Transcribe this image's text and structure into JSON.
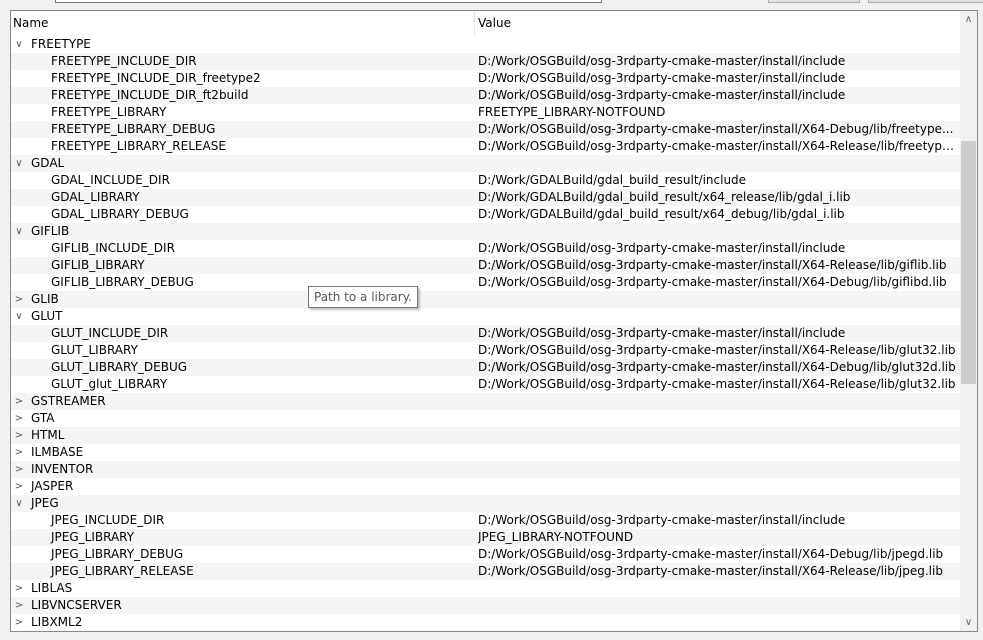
{
  "header": {
    "name": "Name",
    "value": "Value"
  },
  "tooltip": "Path to a library.",
  "scrollbar": {
    "up_icon": "chevron-up",
    "down_icon": "chevron-down"
  },
  "colors": {
    "row_alt": "#f5f5f5",
    "border": "#828790",
    "thumb": "#cdcdcd"
  },
  "rows": [
    {
      "type": "group",
      "name": "FREETYPE",
      "expanded": true
    },
    {
      "type": "entry",
      "name": "FREETYPE_INCLUDE_DIR",
      "value": "D:/Work/OSGBuild/osg-3rdparty-cmake-master/install/include"
    },
    {
      "type": "entry",
      "name": "FREETYPE_INCLUDE_DIR_freetype2",
      "value": "D:/Work/OSGBuild/osg-3rdparty-cmake-master/install/include"
    },
    {
      "type": "entry",
      "name": "FREETYPE_INCLUDE_DIR_ft2build",
      "value": "D:/Work/OSGBuild/osg-3rdparty-cmake-master/install/include"
    },
    {
      "type": "entry",
      "name": "FREETYPE_LIBRARY",
      "value": "FREETYPE_LIBRARY-NOTFOUND"
    },
    {
      "type": "entry",
      "name": "FREETYPE_LIBRARY_DEBUG",
      "value": "D:/Work/OSGBuild/osg-3rdparty-cmake-master/install/X64-Debug/lib/freetype..."
    },
    {
      "type": "entry",
      "name": "FREETYPE_LIBRARY_RELEASE",
      "value": "D:/Work/OSGBuild/osg-3rdparty-cmake-master/install/X64-Release/lib/freetype..."
    },
    {
      "type": "group",
      "name": "GDAL",
      "expanded": true
    },
    {
      "type": "entry",
      "name": "GDAL_INCLUDE_DIR",
      "value": "D:/Work/GDALBuild/gdal_build_result/include"
    },
    {
      "type": "entry",
      "name": "GDAL_LIBRARY",
      "value": "D:/Work/GDALBuild/gdal_build_result/x64_release/lib/gdal_i.lib"
    },
    {
      "type": "entry",
      "name": "GDAL_LIBRARY_DEBUG",
      "value": "D:/Work/GDALBuild/gdal_build_result/x64_debug/lib/gdal_i.lib"
    },
    {
      "type": "group",
      "name": "GIFLIB",
      "expanded": true
    },
    {
      "type": "entry",
      "name": "GIFLIB_INCLUDE_DIR",
      "value": "D:/Work/OSGBuild/osg-3rdparty-cmake-master/install/include"
    },
    {
      "type": "entry",
      "name": "GIFLIB_LIBRARY",
      "value": "D:/Work/OSGBuild/osg-3rdparty-cmake-master/install/X64-Release/lib/giflib.lib"
    },
    {
      "type": "entry",
      "name": "GIFLIB_LIBRARY_DEBUG",
      "value": "D:/Work/OSGBuild/osg-3rdparty-cmake-master/install/X64-Debug/lib/giflibd.lib"
    },
    {
      "type": "group",
      "name": "GLIB",
      "expanded": false
    },
    {
      "type": "group",
      "name": "GLUT",
      "expanded": true
    },
    {
      "type": "entry",
      "name": "GLUT_INCLUDE_DIR",
      "value": "D:/Work/OSGBuild/osg-3rdparty-cmake-master/install/include"
    },
    {
      "type": "entry",
      "name": "GLUT_LIBRARY",
      "value": "D:/Work/OSGBuild/osg-3rdparty-cmake-master/install/X64-Release/lib/glut32.lib"
    },
    {
      "type": "entry",
      "name": "GLUT_LIBRARY_DEBUG",
      "value": "D:/Work/OSGBuild/osg-3rdparty-cmake-master/install/X64-Debug/lib/glut32d.lib"
    },
    {
      "type": "entry",
      "name": "GLUT_glut_LIBRARY",
      "value": "D:/Work/OSGBuild/osg-3rdparty-cmake-master/install/X64-Release/lib/glut32.lib"
    },
    {
      "type": "group",
      "name": "GSTREAMER",
      "expanded": false
    },
    {
      "type": "group",
      "name": "GTA",
      "expanded": false
    },
    {
      "type": "group",
      "name": "HTML",
      "expanded": false
    },
    {
      "type": "group",
      "name": "ILMBASE",
      "expanded": false
    },
    {
      "type": "group",
      "name": "INVENTOR",
      "expanded": false
    },
    {
      "type": "group",
      "name": "JASPER",
      "expanded": false
    },
    {
      "type": "group",
      "name": "JPEG",
      "expanded": true
    },
    {
      "type": "entry",
      "name": "JPEG_INCLUDE_DIR",
      "value": "D:/Work/OSGBuild/osg-3rdparty-cmake-master/install/include"
    },
    {
      "type": "entry",
      "name": "JPEG_LIBRARY",
      "value": "JPEG_LIBRARY-NOTFOUND"
    },
    {
      "type": "entry",
      "name": "JPEG_LIBRARY_DEBUG",
      "value": "D:/Work/OSGBuild/osg-3rdparty-cmake-master/install/X64-Debug/lib/jpegd.lib"
    },
    {
      "type": "entry",
      "name": "JPEG_LIBRARY_RELEASE",
      "value": "D:/Work/OSGBuild/osg-3rdparty-cmake-master/install/X64-Release/lib/jpeg.lib"
    },
    {
      "type": "group",
      "name": "LIBLAS",
      "expanded": false
    },
    {
      "type": "group",
      "name": "LIBVNCSERVER",
      "expanded": false
    },
    {
      "type": "group",
      "name": "LIBXML2",
      "expanded": false
    }
  ]
}
